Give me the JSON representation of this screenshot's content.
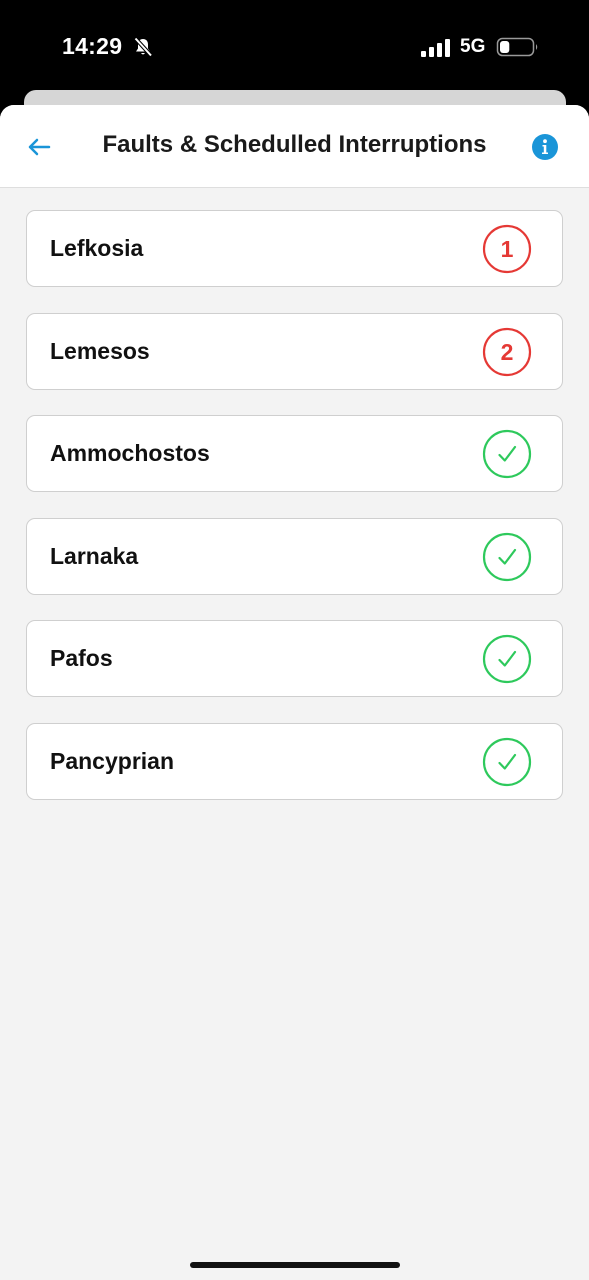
{
  "status_bar": {
    "time": "14:29",
    "network": "5G",
    "bell_icon": "bell-slash-icon",
    "signal_icon": "cellular-signal-icon",
    "battery_icon": "battery-icon",
    "battery_level": 0.3
  },
  "header": {
    "title": "Faults & Schedulled Interruptions",
    "back_icon": "arrow-left-icon",
    "info_icon": "info-icon"
  },
  "colors": {
    "accent": "#1a95d8",
    "alert": "#e53935",
    "ok": "#2ec95c"
  },
  "regions": [
    {
      "name": "Lefkosia",
      "status": "alert",
      "count": "1"
    },
    {
      "name": "Lemesos",
      "status": "alert",
      "count": "2"
    },
    {
      "name": "Ammochostos",
      "status": "ok",
      "icon": "checkmark-icon"
    },
    {
      "name": "Larnaka",
      "status": "ok",
      "icon": "checkmark-icon"
    },
    {
      "name": "Pafos",
      "status": "ok",
      "icon": "checkmark-icon"
    },
    {
      "name": "Pancyprian",
      "status": "ok",
      "icon": "checkmark-icon"
    }
  ]
}
